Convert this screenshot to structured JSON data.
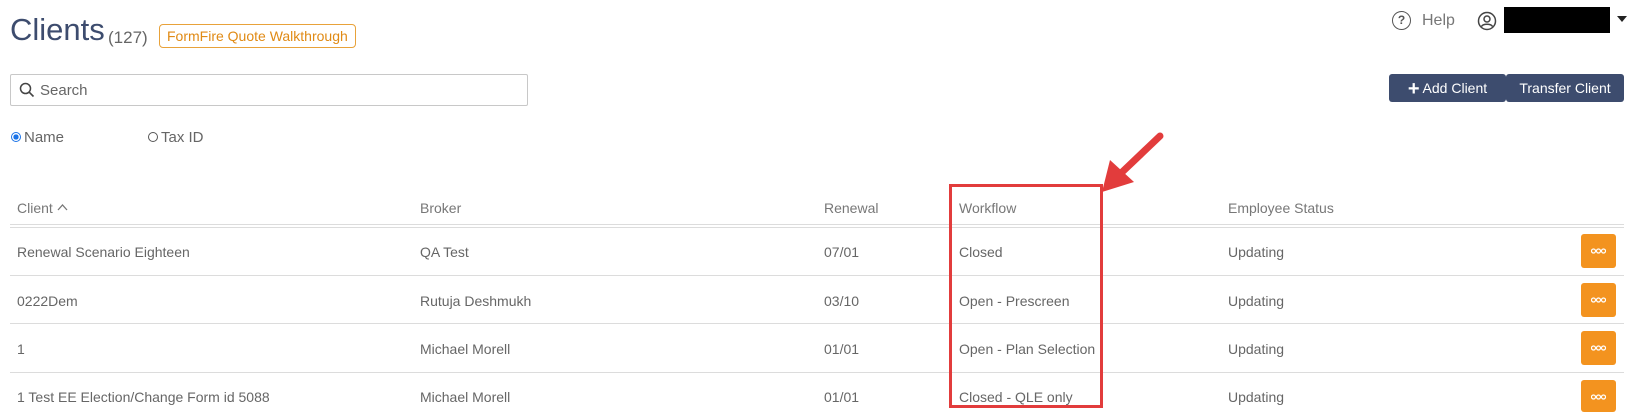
{
  "header": {
    "title": "Clients",
    "count": "(127)",
    "walkthrough_label": "FormFire Quote Walkthrough",
    "help_label": "Help",
    "help_icon_glyph": "?"
  },
  "toolbar": {
    "add_client_plus": "+",
    "add_client_label": "Add Client",
    "transfer_client_label": "Transfer Client"
  },
  "search": {
    "placeholder": "Search",
    "value": ""
  },
  "search_by": {
    "options": [
      {
        "label": "Name",
        "selected": true
      },
      {
        "label": "Tax ID",
        "selected": false
      }
    ]
  },
  "table": {
    "columns": [
      "Client",
      "Broker",
      "Renewal",
      "Workflow",
      "Employee Status"
    ],
    "sort_indicator": "^",
    "rows": [
      {
        "client": "Renewal Scenario Eighteen",
        "broker": "QA Test",
        "renewal": "07/01",
        "workflow": "Closed",
        "employee_status": "Updating"
      },
      {
        "client": "0222Dem",
        "broker": "Rutuja Deshmukh",
        "renewal": "03/10",
        "workflow": "Open - Prescreen",
        "employee_status": "Updating"
      },
      {
        "client": "1",
        "broker": "Michael Morell",
        "renewal": "01/01",
        "workflow": "Open - Plan Selection",
        "employee_status": "Updating"
      },
      {
        "client": "1 Test EE Election/Change Form id 5088",
        "broker": "Michael Morell",
        "renewal": "01/01",
        "workflow": "Closed - QLE only",
        "employee_status": "Updating"
      }
    ]
  },
  "colors": {
    "primary": "#3d4c6e",
    "accent_orange": "#f3931f",
    "annotation_red": "#e23c3c"
  },
  "icons": [
    "help-circle-icon",
    "user-circle-icon",
    "search-icon",
    "chevron-up-icon",
    "more-dots-icon",
    "annotation-arrow-icon"
  ]
}
